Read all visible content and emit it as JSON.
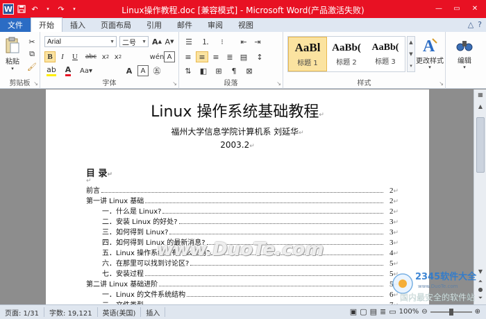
{
  "window": {
    "title": "Linux操作教程.doc [兼容模式] - Microsoft Word(产品激活失败)",
    "app_icon_letter": "W"
  },
  "tabs": [
    {
      "label": "文件"
    },
    {
      "label": "开始"
    },
    {
      "label": "插入"
    },
    {
      "label": "页面布局"
    },
    {
      "label": "引用"
    },
    {
      "label": "邮件"
    },
    {
      "label": "审阅"
    },
    {
      "label": "视图"
    }
  ],
  "ribbon": {
    "clipboard": {
      "label": "剪贴板",
      "paste_label": "粘贴"
    },
    "font": {
      "label": "字体",
      "font_name": "Arial",
      "font_size": "二号"
    },
    "paragraph": {
      "label": "段落"
    },
    "styles": {
      "label": "样式",
      "items": [
        {
          "preview": "AaBl",
          "name": "标题 1"
        },
        {
          "preview": "AaBb(",
          "name": "标题 2"
        },
        {
          "preview": "AaBb(",
          "name": "标题 3"
        }
      ],
      "change_styles_label": "更改样式"
    },
    "editing": {
      "label": "编辑"
    }
  },
  "document": {
    "title": "Linux 操作系统基础教程",
    "author": "福州大学信息学院计算机系  刘延华",
    "date": "2003.2",
    "toc_heading": "目 录",
    "toc": [
      {
        "text": "前言",
        "page": "2",
        "level": 1
      },
      {
        "text": "第一讲  Linux 基础",
        "page": "2",
        "level": 1
      },
      {
        "text": "一．什么是 Linux?",
        "page": "2",
        "level": 2
      },
      {
        "text": "二．安装 Linux 的好处?",
        "page": "3",
        "level": 2
      },
      {
        "text": "三．如何得到 Linux?",
        "page": "3",
        "level": 2
      },
      {
        "text": "四．如何得到 Linux 的最新消息?",
        "page": "3",
        "level": 2
      },
      {
        "text": "五．Linux 操作系统上有什么应用?",
        "page": "4",
        "level": 2
      },
      {
        "text": "六．在那里可以找到讨论区?",
        "page": "5",
        "level": 2
      },
      {
        "text": "七．安装过程",
        "page": "5",
        "level": 2
      },
      {
        "text": "第二讲  Linux 基础进阶",
        "page": "5",
        "level": 1
      },
      {
        "text": "一．Linux 的文件系统结构",
        "page": "6",
        "level": 2
      },
      {
        "text": "二．文件类型",
        "page": "7",
        "level": 2
      }
    ],
    "watermark": "www.DuoTe.com"
  },
  "status": {
    "page": "页面: 1/31",
    "words": "字数: 19,121",
    "language": "英语(美国)",
    "mode": "插入",
    "zoom": "100%"
  },
  "brand": {
    "name": "2345软件大全",
    "url": "www.DuoTe.com",
    "slogan": "国内最安全的软件站"
  },
  "colors": {
    "titlebar": "#e81123",
    "file_tab": "#2b6cc4",
    "style_selected": "#fbe3a0"
  }
}
